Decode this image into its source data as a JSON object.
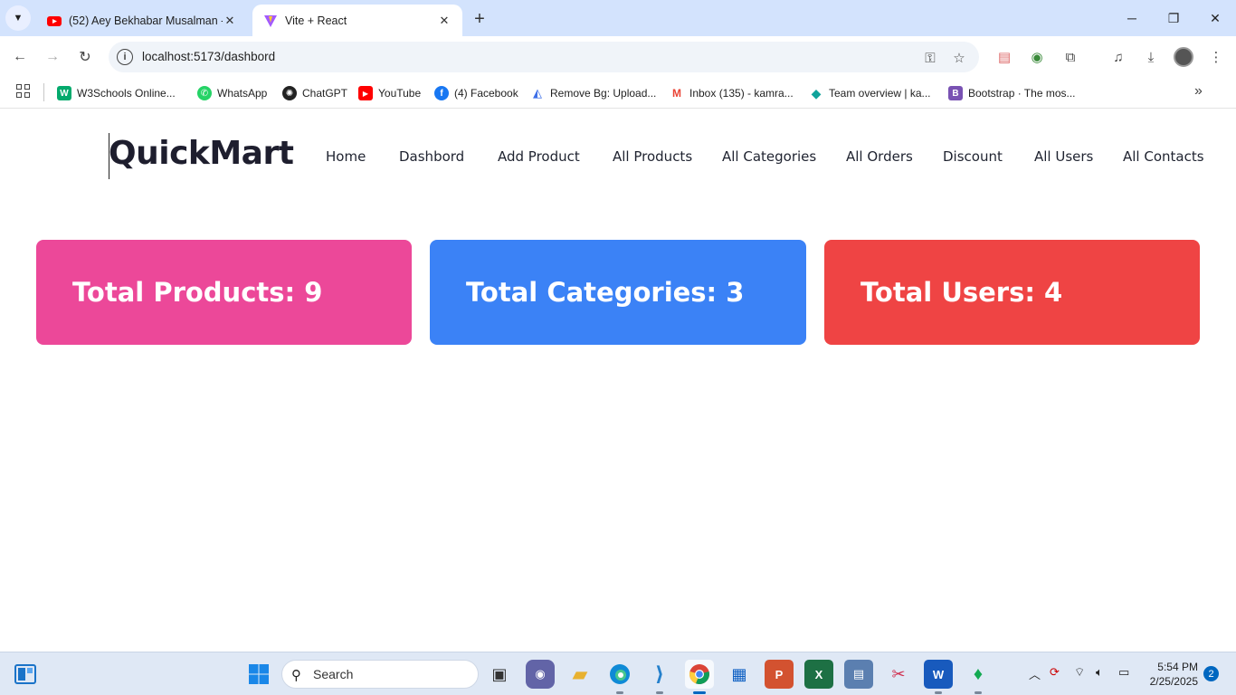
{
  "browser": {
    "tabs": [
      {
        "title": "(52) Aey Bekhabar Musalman - ",
        "favicon": "youtube-icon",
        "active": false
      },
      {
        "title": "Vite + React",
        "favicon": "vite-icon",
        "active": true
      }
    ],
    "address": "localhost:5173/dashbord",
    "bookmarks": [
      {
        "label": "W3Schools Online...",
        "icon": "w3schools-icon",
        "color": "#04aa6d",
        "glyph": "W"
      },
      {
        "label": "WhatsApp",
        "icon": "whatsapp-icon",
        "color": "#25d366",
        "glyph": "✆"
      },
      {
        "label": "ChatGPT",
        "icon": "chatgpt-icon",
        "color": "#222222",
        "glyph": "✺"
      },
      {
        "label": "YouTube",
        "icon": "youtube-icon",
        "color": "#ff0000",
        "glyph": "▶"
      },
      {
        "label": "(4) Facebook",
        "icon": "facebook-icon",
        "color": "#1877f2",
        "glyph": "f"
      },
      {
        "label": "Remove Bg: Upload...",
        "icon": "removebg-icon",
        "color": "#3d6fe8",
        "glyph": "◭"
      },
      {
        "label": "Inbox (135) - kamra...",
        "icon": "gmail-icon",
        "color": "#ea4335",
        "glyph": "M"
      },
      {
        "label": "Team overview | ka...",
        "icon": "diamond-icon",
        "color": "#10a39b",
        "glyph": "◆"
      },
      {
        "label": "Bootstrap · The mos...",
        "icon": "bootstrap-icon",
        "color": "#7952b3",
        "glyph": "B"
      }
    ]
  },
  "app": {
    "brand": "QuickMart",
    "nav": [
      "Home",
      "Dashbord",
      "Add Product",
      "All Products",
      "All Categories",
      "All Orders",
      "Discount",
      "All Users",
      "All Contacts"
    ],
    "cards": {
      "products": "Total Products: 9",
      "categories": "Total Categories: 3",
      "users": "Total Users: 4"
    },
    "colors": {
      "products": "#ec4899",
      "categories": "#3b82f6",
      "users": "#ef4444"
    }
  },
  "taskbar": {
    "search_placeholder": "Search",
    "time": "5:54 PM",
    "date": "2/25/2025",
    "notifications": "2"
  }
}
